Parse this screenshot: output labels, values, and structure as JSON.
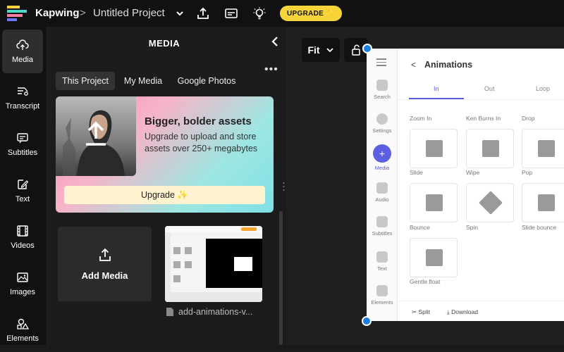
{
  "topbar": {
    "brand": "Kapwing",
    "separator": ">",
    "project_title": "Untitled Project",
    "upgrade_label": "UPGRADE ✨",
    "accent": "#f7d43a"
  },
  "sidebar": {
    "items": [
      {
        "label": "Media",
        "icon": "upload-cloud-icon",
        "active": true
      },
      {
        "label": "Transcript",
        "icon": "transcript-icon"
      },
      {
        "label": "Subtitles",
        "icon": "subtitles-icon"
      },
      {
        "label": "Text",
        "icon": "text-edit-icon"
      },
      {
        "label": "Videos",
        "icon": "film-icon"
      },
      {
        "label": "Images",
        "icon": "image-icon"
      },
      {
        "label": "Elements",
        "icon": "shapes-icon"
      }
    ]
  },
  "panel": {
    "title": "MEDIA",
    "tabs": [
      "This Project",
      "My Media",
      "Google Photos"
    ],
    "active_tab": "This Project",
    "promo": {
      "title": "Bigger, bolder assets",
      "text": "Upgrade to upload and store assets over 250+ megabytes",
      "button": "Upgrade ✨"
    },
    "add_media_label": "Add Media",
    "file_name": "add-animations-v..."
  },
  "canvas": {
    "fit_label": "Fit"
  },
  "preview": {
    "header": "Animations",
    "back": "<",
    "tabs": [
      "In",
      "Out",
      "Loop"
    ],
    "rail": [
      "Search",
      "Settings",
      "Media",
      "Audio",
      "Subtitles",
      "Text",
      "Elements"
    ],
    "top_labels": [
      "Zoom In",
      "Ken Burns In",
      "Drop"
    ],
    "row1": [
      "Slide",
      "Wipe",
      "Pop"
    ],
    "row2": [
      "Bounce",
      "Spin",
      "Slide bounce"
    ],
    "row3": [
      "Gentle float"
    ],
    "footer": [
      "Split",
      "Download"
    ],
    "accent": "#5b5fe0"
  }
}
